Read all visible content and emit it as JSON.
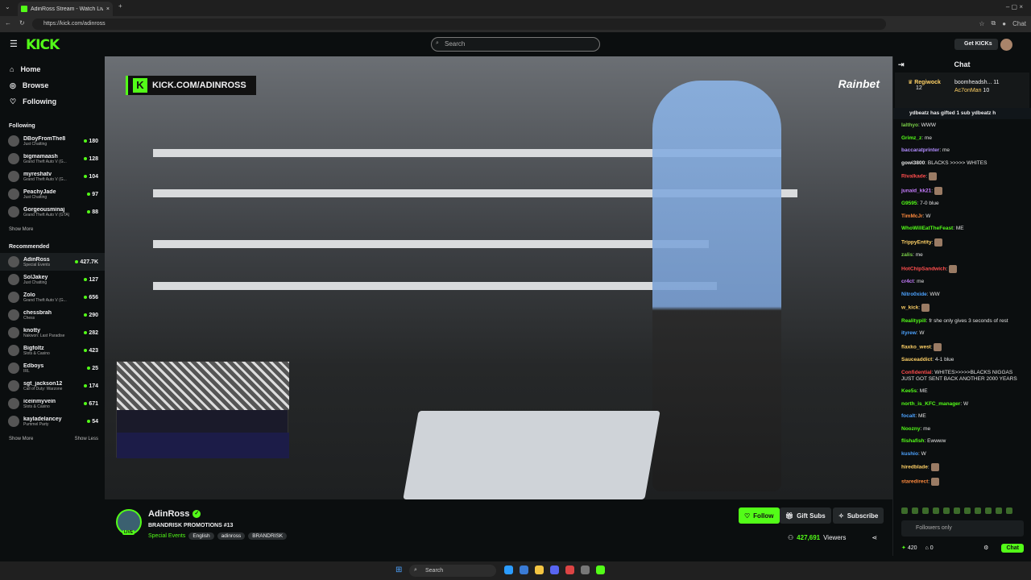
{
  "browser": {
    "tab_title": "AdinRoss Stream - Watch Live",
    "url": "https://kick.com/adinross",
    "chat_ext_label": "Chat"
  },
  "topnav": {
    "logo": "KICK",
    "search_placeholder": "Search",
    "get_kicks": "Get KICKs"
  },
  "sidebar": {
    "nav": [
      {
        "label": "Home",
        "icon": "home-icon"
      },
      {
        "label": "Browse",
        "icon": "browse-icon"
      },
      {
        "label": "Following",
        "icon": "heart-icon"
      }
    ],
    "following_title": "Following",
    "following": [
      {
        "name": "DBoyFromThe8",
        "category": "Just Chatting",
        "viewers": "180"
      },
      {
        "name": "bigmamaash",
        "category": "Grand Theft Auto V (G...",
        "viewers": "128"
      },
      {
        "name": "myreshatv",
        "category": "Grand Theft Auto V (G...",
        "viewers": "104"
      },
      {
        "name": "PeachyJade",
        "category": "Just Chatting",
        "viewers": "97"
      },
      {
        "name": "Gorgeousminaj",
        "category": "Grand Theft Auto V (GTA)",
        "viewers": "88"
      }
    ],
    "show_more_1": "Show More",
    "recommended_title": "Recommended",
    "recommended": [
      {
        "name": "AdinRoss",
        "category": "Special Events",
        "viewers": "427.7K"
      },
      {
        "name": "SolJakey",
        "category": "Just Chatting",
        "viewers": "127"
      },
      {
        "name": "Zolo",
        "category": "Grand Theft Auto V (G...",
        "viewers": "656"
      },
      {
        "name": "chessbrah",
        "category": "Chess",
        "viewers": "290"
      },
      {
        "name": "knotty",
        "category": "Nakwon: Last Paradise",
        "viewers": "282"
      },
      {
        "name": "Bigfoltz",
        "category": "Slots & Casino",
        "viewers": "423"
      },
      {
        "name": "Edboys",
        "category": "IRL",
        "viewers": "25"
      },
      {
        "name": "sgt_jackson12",
        "category": "Call of Duty: Warzone",
        "viewers": "174"
      },
      {
        "name": "iceinmyvein",
        "category": "Slots & Casino",
        "viewers": "671"
      },
      {
        "name": "kayladelancey",
        "category": "Pummel Party",
        "viewers": "54"
      }
    ],
    "show_more_2": "Show More",
    "show_less": "Show Less"
  },
  "video": {
    "overlay_url": "KICK.COM/ADINROSS",
    "sponsor": "Rainbet"
  },
  "stream": {
    "streamer": "AdinRoss",
    "live": "LIVE",
    "title": "BRANDRISK PROMOTIONS #13",
    "category": "Special Events",
    "tags": [
      "English",
      "adinross",
      "BRANDRISK"
    ],
    "follow": "Follow",
    "gift_subs": "Gift Subs",
    "subscribe": "Subscribe",
    "viewers": "427,691",
    "viewers_label": "Viewers"
  },
  "chat": {
    "title": "Chat",
    "pinned_left_user": "Regiwock",
    "pinned_left_count": "12",
    "pinned_right_1": "boomheadsh...",
    "pinned_right_1_count": "11",
    "pinned_right_2": "Ac7onMan",
    "pinned_right_2_count": "10",
    "gift_line": "ydbeatz has gifted 1 sub  ydbeatz h",
    "messages": [
      {
        "user": "lalthyo",
        "text": "WWW",
        "color": "#7bd148"
      },
      {
        "user": "Grimz_z",
        "text": "me",
        "color": "#53fc18"
      },
      {
        "user": "baccaratprinter",
        "text": "me",
        "color": "#b18cff"
      },
      {
        "user": "gowi3800",
        "text": "BLACKS >>>>> WHITES",
        "color": "#e6e6e6"
      },
      {
        "user": "Rivalkade",
        "text": "",
        "color": "#ff4d4d"
      },
      {
        "user": "junaid_kk21",
        "text": "",
        "color": "#c77dff"
      },
      {
        "user": "G9595",
        "text": "7-0 blue",
        "color": "#53fc18"
      },
      {
        "user": "TimMcJr",
        "text": "W",
        "color": "#ff8a3d"
      },
      {
        "user": "WhoWillEatTheFeast",
        "text": "ME",
        "color": "#53fc18"
      },
      {
        "user": "TrippyEntity",
        "text": "",
        "color": "#ffd166"
      },
      {
        "user": "zalis",
        "text": "me",
        "color": "#7bd148"
      },
      {
        "user": "HotChipSandwich",
        "text": "",
        "color": "#ff4d4d"
      },
      {
        "user": "cr4ct",
        "text": "me",
        "color": "#c77dff"
      },
      {
        "user": "Nitro0xide",
        "text": "WW",
        "color": "#4da3ff"
      },
      {
        "user": "w_kick",
        "text": "",
        "color": "#ffd166"
      },
      {
        "user": "Realitypill",
        "text": "fr she only gives 3 seconds of rest",
        "color": "#53fc18"
      },
      {
        "user": "ityrew",
        "text": "W",
        "color": "#4da3ff"
      },
      {
        "user": "flaxko_west",
        "text": "",
        "color": "#ffd166"
      },
      {
        "user": "Sauceaddict",
        "text": "4-1 blue",
        "color": "#ffd166"
      },
      {
        "user": "Confidential",
        "text": "WHITES>>>>>BLACKS NIGGAS JUST GOT SENT BACK ANOTHER 2000 YEARS",
        "color": "#ff4d4d"
      },
      {
        "user": "Kee5s",
        "text": "ME",
        "color": "#53fc18"
      },
      {
        "user": "north_is_KFC_manager",
        "text": "W",
        "color": "#53fc18"
      },
      {
        "user": "focalt",
        "text": "ME",
        "color": "#4da3ff"
      },
      {
        "user": "Noozny",
        "text": "me",
        "color": "#53fc18"
      },
      {
        "user": "flishafish",
        "text": "Ewwww",
        "color": "#53fc18"
      },
      {
        "user": "kushio",
        "text": "W",
        "color": "#4da3ff"
      },
      {
        "user": "hiredblade",
        "text": "",
        "color": "#ffd166"
      },
      {
        "user": "staredirect",
        "text": "",
        "color": "#ff8a3d"
      }
    ],
    "input_placeholder": "Followers only",
    "points": "420",
    "subs_count": "0",
    "send": "Chat"
  },
  "taskbar": {
    "search": "Search"
  },
  "colors": {
    "accent": "#53fc18",
    "bg": "#0b0e0f"
  }
}
